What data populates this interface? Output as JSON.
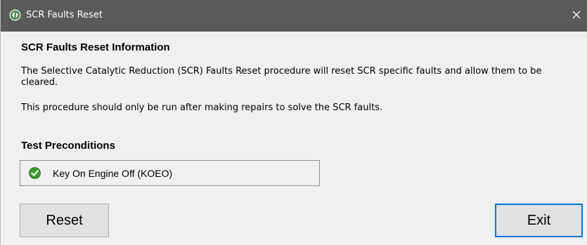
{
  "window": {
    "title": "SCR Faults Reset",
    "colors": {
      "titlebar": "#5a5a5a",
      "background": "#f0f0f0",
      "focus_border": "#0078d7",
      "check_green": "#3a9a2a"
    }
  },
  "info": {
    "heading": "SCR Faults Reset Information",
    "paragraph1": "The Selective Catalytic Reduction (SCR) Faults Reset procedure will reset SCR specific faults and allow them to be cleared.",
    "paragraph2": "This procedure should only be run after making repairs to solve the SCR faults."
  },
  "preconditions": {
    "heading": "Test Preconditions",
    "items": [
      {
        "label": "Key On Engine Off (KOEO)",
        "icon": "green-check-icon"
      }
    ]
  },
  "buttons": {
    "reset_label": "Reset",
    "exit_label": "Exit"
  }
}
